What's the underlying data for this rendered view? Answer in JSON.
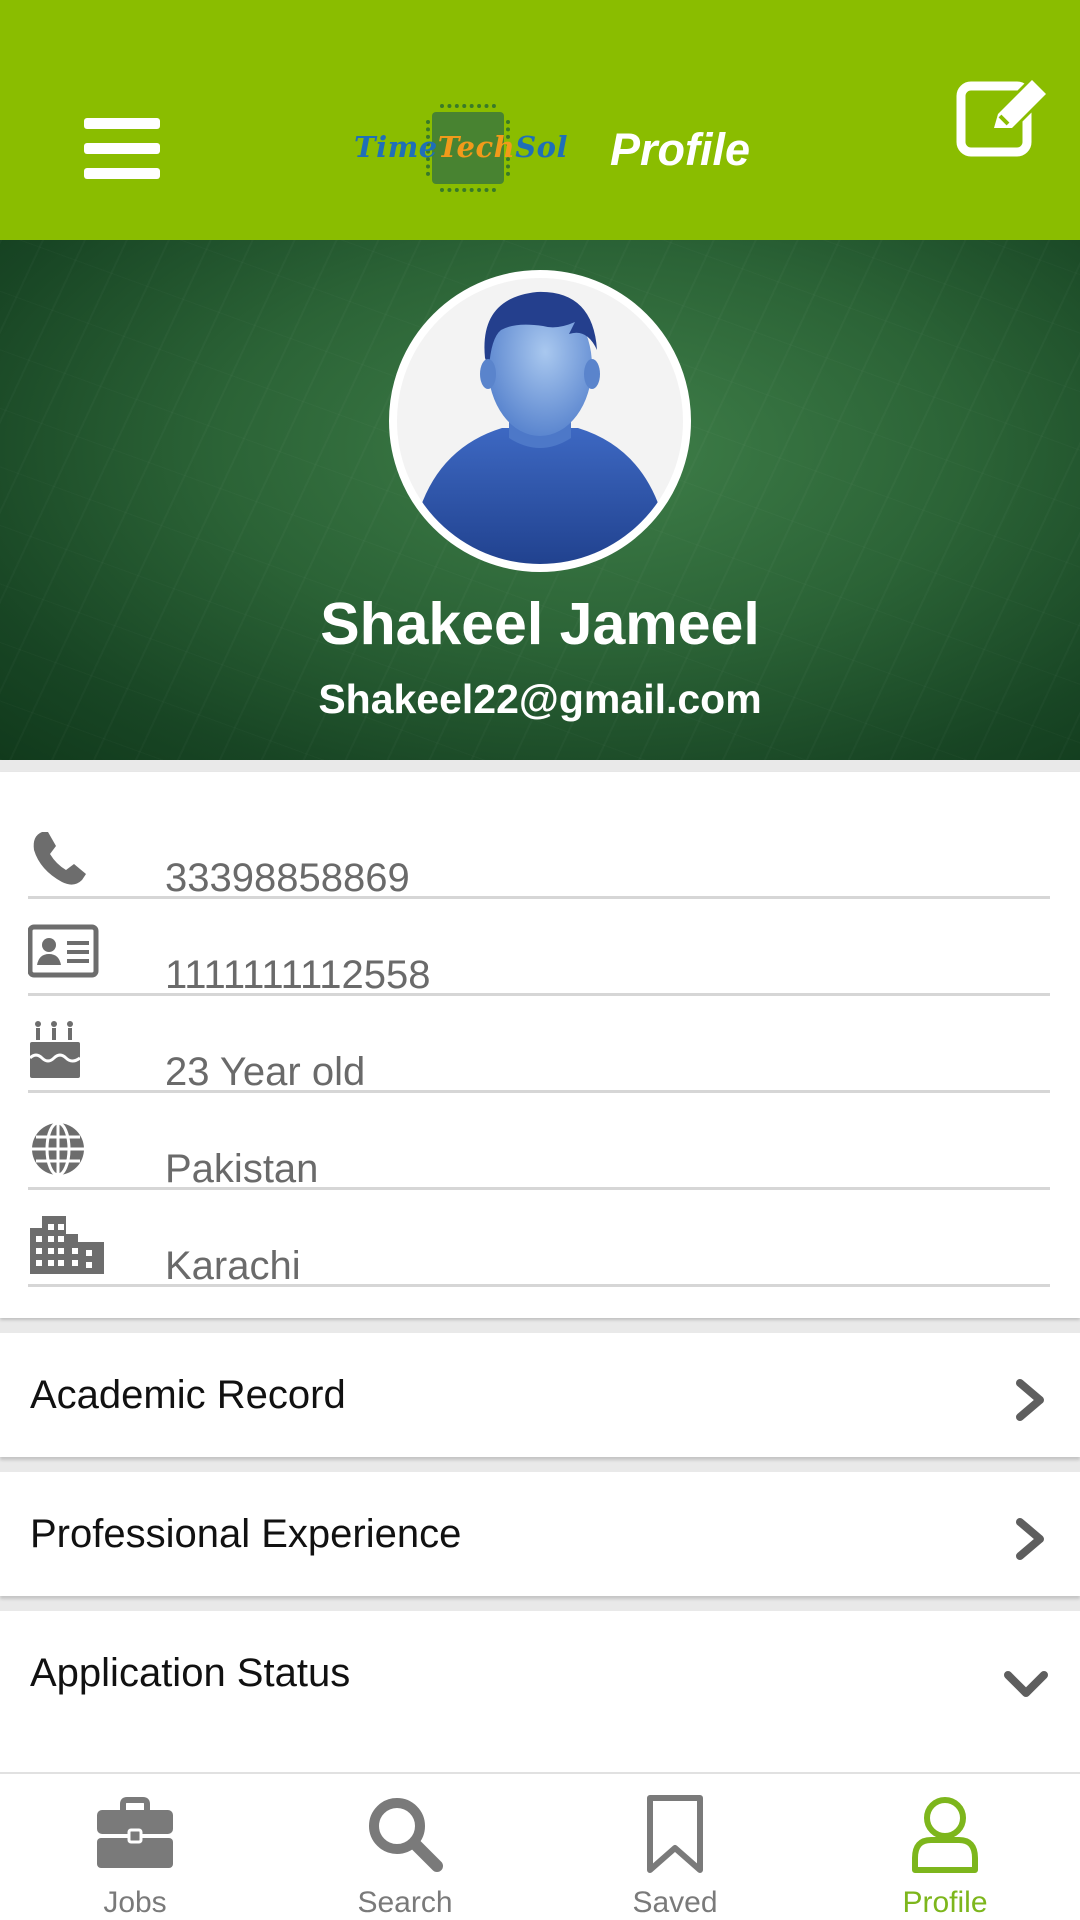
{
  "app_bar": {
    "logo_text": {
      "part1": "Time",
      "part2": "Tech",
      "part3": "Sol"
    },
    "title": "Profile",
    "menu_icon": "hamburger-menu-icon",
    "edit_icon": "edit-icon"
  },
  "profile": {
    "name": "Shakeel Jameel",
    "email": "Shakeel22@gmail.com"
  },
  "info": {
    "phone": "33398858869",
    "id_card": "1111111112558",
    "age": "23 Year old",
    "country": "Pakistan",
    "city": "Karachi"
  },
  "sections": {
    "academic": "Academic Record",
    "professional": "Professional Experience",
    "application": "Application Status"
  },
  "bottom_nav": {
    "jobs": "Jobs",
    "search": "Search",
    "saved": "Saved",
    "profile": "Profile",
    "active": "Profile"
  },
  "colors": {
    "primary": "#8abd00",
    "active_tab": "#7db61c",
    "icon_gray": "#6d6d6d"
  }
}
